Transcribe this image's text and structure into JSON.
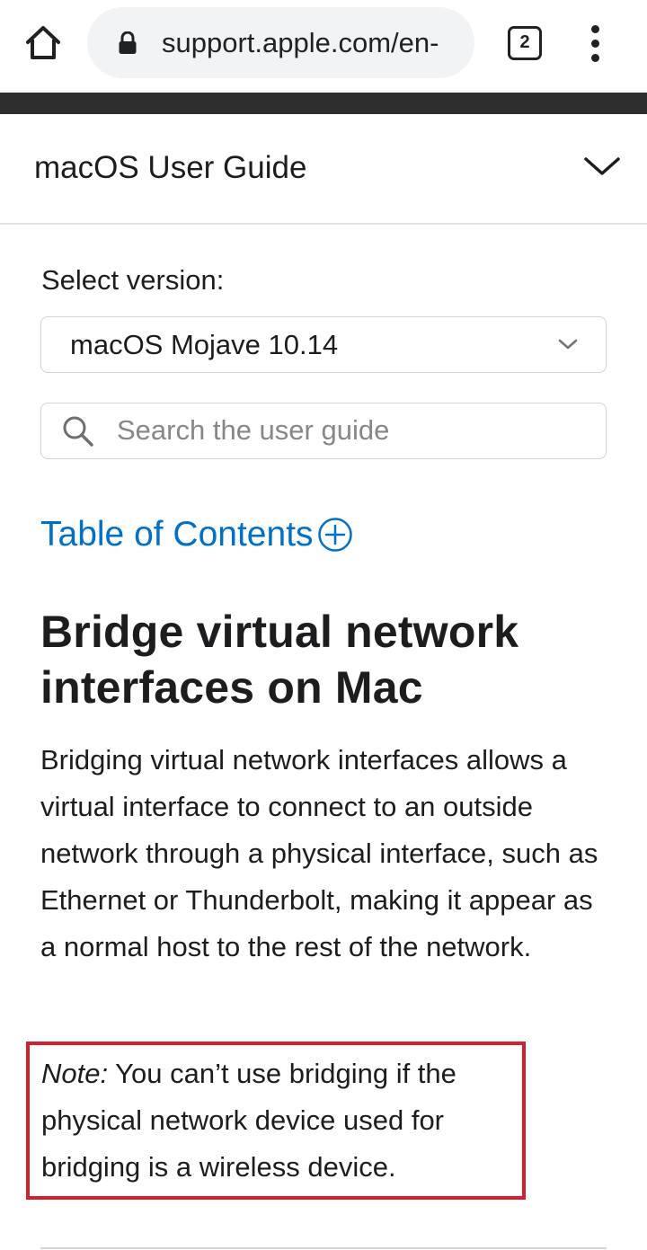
{
  "browser": {
    "url": "support.apple.com/en-",
    "tab_count": "2"
  },
  "guide": {
    "title": "macOS User Guide"
  },
  "version": {
    "label": "Select version:",
    "selected": "macOS Mojave 10.14"
  },
  "search": {
    "placeholder": "Search the user guide"
  },
  "toc": {
    "label": "Table of Contents"
  },
  "article": {
    "title": "Bridge virtual network interfaces on Mac",
    "body": "Bridging virtual network interfaces allows a virtual interface to connect to an outside network through a physical interface, such as Ethernet or Thunderbolt, making it appear as a normal host to the rest of the network.",
    "note_prefix": "Note:",
    "note_text": " You can’t use bridging if the physical network device used for bridging is a wireless device."
  },
  "colors": {
    "link": "#0070c9",
    "highlight_border": "#d3202f",
    "toolbar_band": "#2e2e2e"
  },
  "icons": [
    "home-icon",
    "lock-icon",
    "tabs-icon",
    "more-vert-icon",
    "chevron-down-icon",
    "search-icon",
    "plus-circle-icon"
  ]
}
